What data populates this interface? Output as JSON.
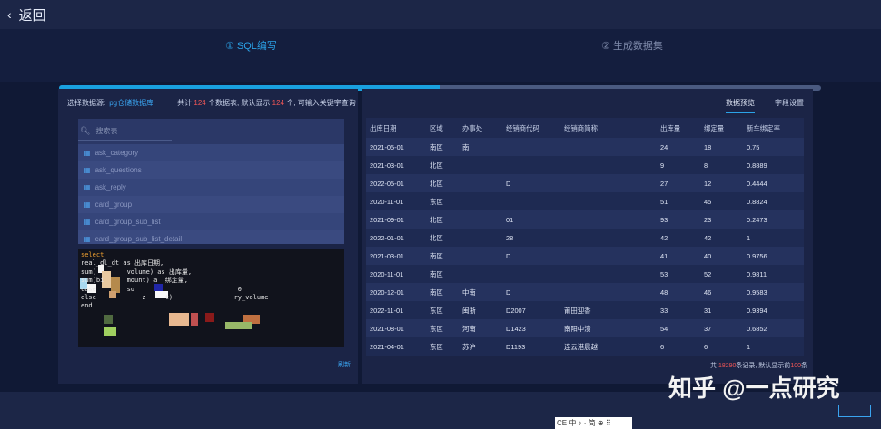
{
  "topbar": {
    "back_label": "返回"
  },
  "steps": [
    {
      "label": "① SQL编写"
    },
    {
      "label": "② 生成数据集"
    }
  ],
  "progress": {
    "fraction": 0.5,
    "color": "#19a1df"
  },
  "left_panel": {
    "datasource_label": "选择数据源:",
    "datasource_name": "pg仓储数据库",
    "info_prefix": "共计",
    "table_count": "124",
    "info_mid": "个数据表, 默认显示",
    "shown_count": "124",
    "info_suffix": "个, 可输入关键字查询",
    "search_placeholder": "搜索表",
    "tables": [
      "ask_category",
      "ask_questions",
      "ask_reply",
      "card_group",
      "card_group_sub_list",
      "card_group_sub_list_detail"
    ],
    "refresh_label": "刷新",
    "sql_lines": [
      "select",
      "real_dl_dt as 出库日期,",
      "",
      "",
      "",
      "sum(        volume) as 出库量,",
      "sum(bi      mount) a  绑定量,",
      "case        su                           0",
      "else            z     t)                ry_volume",
      "",
      "end"
    ]
  },
  "right_panel": {
    "tabs": [
      "数据预览",
      "字段设置"
    ],
    "columns": [
      "出库日期",
      "区域",
      "办事处",
      "经销商代码",
      "经销商简称",
      "出库量",
      "绑定量",
      "新车绑定率"
    ],
    "rows": [
      [
        "2021-05-01",
        "南区",
        "南",
        "",
        "",
        "24",
        "18",
        "0.75"
      ],
      [
        "2021-03-01",
        "北区",
        "",
        "",
        "",
        "9",
        "8",
        "0.8889"
      ],
      [
        "2022-05-01",
        "北区",
        "",
        "D",
        "",
        "27",
        "12",
        "0.4444"
      ],
      [
        "2020-11-01",
        "东区",
        "",
        "",
        "",
        "51",
        "45",
        "0.8824"
      ],
      [
        "2021-09-01",
        "北区",
        "",
        "01",
        "",
        "93",
        "23",
        "0.2473"
      ],
      [
        "2022-01-01",
        "北区",
        "",
        "28",
        "",
        "42",
        "42",
        "1"
      ],
      [
        "2021-03-01",
        "南区",
        "",
        "D",
        "",
        "41",
        "40",
        "0.9756"
      ],
      [
        "2020-11-01",
        "南区",
        "",
        "",
        "",
        "53",
        "52",
        "0.9811"
      ],
      [
        "2020-12-01",
        "南区",
        "中南",
        "D",
        "",
        "48",
        "46",
        "0.9583"
      ],
      [
        "2022-11-01",
        "东区",
        "闽浙",
        "D2007",
        "莆田迎香",
        "33",
        "31",
        "0.9394"
      ],
      [
        "2021-08-01",
        "东区",
        "河南",
        "D1423",
        "南阳中溃",
        "54",
        "37",
        "0.6852"
      ],
      [
        "2021-04-01",
        "东区",
        "苏沪",
        "D1193",
        "连云港晨越",
        "6",
        "6",
        "1"
      ]
    ],
    "footer_prefix": "共",
    "footer_count": "18290",
    "footer_suffix": "条记录, 默认显示前",
    "footer_shown": "100",
    "footer_end": "条"
  },
  "watermark": "知乎 @一点研究",
  "ime_bar": "CE 中 ♪ ·  简 ⊕ ⠿",
  "corner_button": ""
}
